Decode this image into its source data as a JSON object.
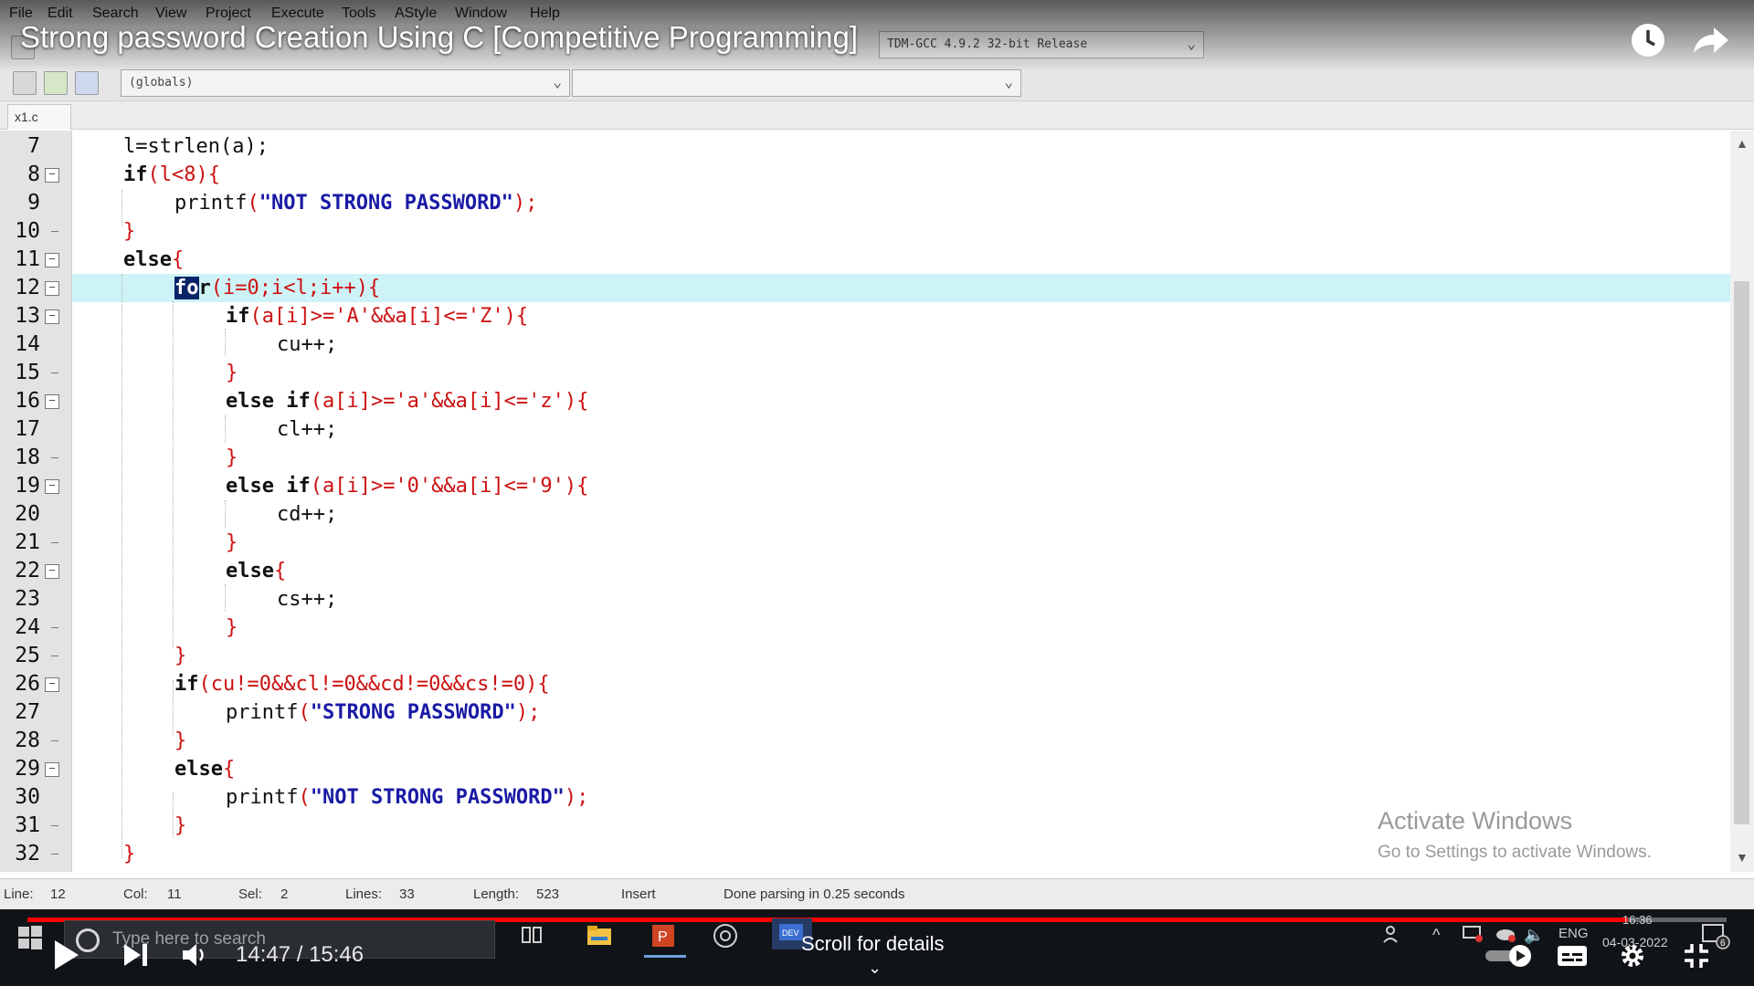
{
  "video": {
    "title": "Strong password Creation Using C [Competitive Programming]",
    "time": "14:47 / 15:46",
    "scroll_hint": "Scroll for details",
    "progress": 0.942
  },
  "ide": {
    "menu": [
      "File",
      "Edit",
      "Search",
      "View",
      "Project",
      "Execute",
      "Tools",
      "AStyle",
      "Window",
      "Help"
    ],
    "compiler": "TDM-GCC 4.9.2 32-bit Release",
    "scope": "(globals)",
    "file_tab": "x1.c",
    "line_numbers": [
      "7",
      "8",
      "9",
      "10",
      "11",
      "12",
      "13",
      "14",
      "15",
      "16",
      "17",
      "18",
      "19",
      "20",
      "21",
      "22",
      "23",
      "24",
      "25",
      "26",
      "27",
      "28",
      "29",
      "30",
      "31",
      "32"
    ]
  },
  "code": {
    "l7": "l=strlen(a);",
    "l8_kw": "if",
    "l8_rest": "(l<8){",
    "l9_fn": "printf",
    "l9_open": "(",
    "l9_str": "\"NOT STRONG PASSWORD\"",
    "l9_close": ");",
    "l10": "}",
    "l11_kw": "else",
    "l11_b": "{",
    "l12_sel": "fo",
    "l12_rest": "r",
    "l12_args": "(i=0;i<l;i++){",
    "l13_kw": "if",
    "l13_rest": "(a[i]>='A'&&a[i]<='Z'){",
    "l14": "cu++;",
    "l15": "}",
    "l16_kw": "else if",
    "l16_rest": "(a[i]>='a'&&a[i]<='z'){",
    "l17": "cl++;",
    "l18": "}",
    "l19_kw": "else if",
    "l19_rest": "(a[i]>='0'&&a[i]<='9'){",
    "l20": "cd++;",
    "l21": "}",
    "l22_kw": "else",
    "l22_b": "{",
    "l23": "cs++;",
    "l24": "}",
    "l25": "}",
    "l26_kw": "if",
    "l26_rest": "(cu!=0&&cl!=0&&cd!=0&&cs!=0){",
    "l27_fn": "printf",
    "l27_open": "(",
    "l27_str": "\"STRONG PASSWORD\"",
    "l27_close": ");",
    "l28": "}",
    "l29_kw": "else",
    "l29_b": "{",
    "l30_fn": "printf",
    "l30_open": "(",
    "l30_str": "\"NOT STRONG PASSWORD\"",
    "l30_close": ");",
    "l31": "}",
    "l32": "}"
  },
  "status": {
    "line_label": "Line:",
    "line_value": "12",
    "col_label": "Col:",
    "col_value": "11",
    "sel_label": "Sel:",
    "sel_value": "2",
    "lines_label": "Lines:",
    "lines_value": "33",
    "length_label": "Length:",
    "length_value": "523",
    "mode": "Insert",
    "message": "Done parsing in 0.25 seconds"
  },
  "watermark": {
    "line1": "Activate Windows",
    "line2": "Go to Settings to activate Windows."
  },
  "taskbar": {
    "search_placeholder": "Type here to search",
    "lang": "ENG",
    "clock_time": "16:36",
    "clock_date": "04-03-2022",
    "notification_count": "6"
  },
  "colors": {
    "accent_progress": "#ff0000",
    "current_line": "#cdf3f7",
    "string": "#1a1aa6",
    "operator": "#cc1111"
  }
}
